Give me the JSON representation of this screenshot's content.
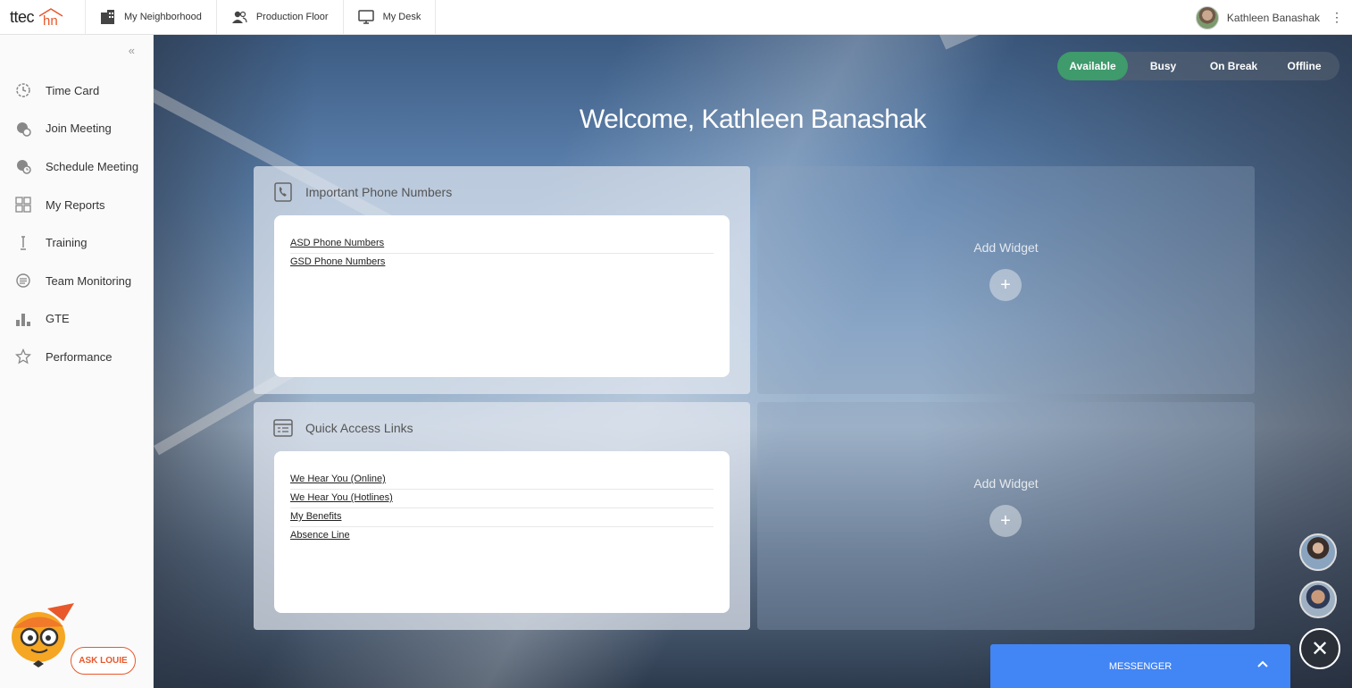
{
  "topbar": {
    "logo_text": "ttec",
    "logo_hn": "hn",
    "nav": [
      {
        "label": "My Neighborhood",
        "icon": "building-icon"
      },
      {
        "label": "Production Floor",
        "icon": "people-icon"
      },
      {
        "label": "My Desk",
        "icon": "monitor-icon"
      }
    ],
    "user_name": "Kathleen Banashak",
    "menu_icon": "kebab-icon"
  },
  "sidebar": {
    "collapse_glyph": "«",
    "items": [
      {
        "label": "Time Card",
        "icon": "clock-icon"
      },
      {
        "label": "Join Meeting",
        "icon": "meeting-join-icon"
      },
      {
        "label": "Schedule Meeting",
        "icon": "meeting-schedule-icon"
      },
      {
        "label": "My Reports",
        "icon": "grid-icon"
      },
      {
        "label": "Training",
        "icon": "training-icon"
      },
      {
        "label": "Team Monitoring",
        "icon": "monitoring-icon"
      },
      {
        "label": "GTE",
        "icon": "bar-chart-icon"
      },
      {
        "label": "Performance",
        "icon": "star-icon"
      }
    ],
    "ask_louie": "ASK LOUIE"
  },
  "status": {
    "options": [
      "Available",
      "Busy",
      "On Break",
      "Offline"
    ],
    "selected": "Available",
    "active_color": "#3f9a6c"
  },
  "welcome": "Welcome, Kathleen Banashak",
  "widgets": {
    "phone": {
      "title": "Important Phone Numbers",
      "links": [
        "ASD Phone Numbers",
        "GSD Phone Numbers"
      ]
    },
    "quick": {
      "title": "Quick Access Links",
      "links": [
        "We Hear You (Online)",
        "We Hear You (Hotlines)",
        "My Benefits",
        "Absence Line"
      ]
    },
    "add_widget_label": "Add Widget",
    "add_glyph": "+"
  },
  "messenger": {
    "label": "MESSENGER",
    "chevron": "^",
    "close_glyph": "✕",
    "color": "#4285f4"
  }
}
